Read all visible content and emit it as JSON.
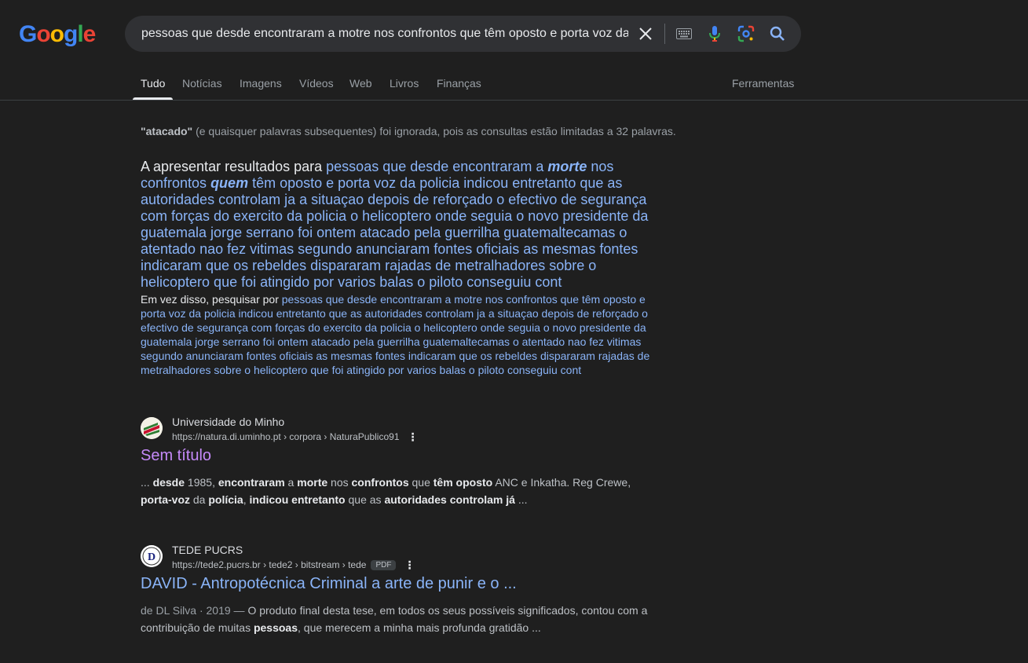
{
  "header": {
    "logo_text": "Google",
    "search_query": "pessoas que desde encontraram a motre nos confrontos que têm oposto e porta voz da policia indicou",
    "icons": [
      "close-icon",
      "keyboard-icon",
      "microphone-icon",
      "lens-icon",
      "search-icon"
    ]
  },
  "tabs": [
    "Tudo",
    "Notícias",
    "Imagens",
    "Vídeos",
    "Web",
    "Livros",
    "Finanças"
  ],
  "active_tab": "Tudo",
  "tools_label": "Ferramentas",
  "notice": {
    "term": "\"atacado\"",
    "rest": " (e quaisquer palavras subsequentes) foi ignorada, pois as consultas estão limitadas a 32 palavras."
  },
  "correction": {
    "prefix": "A apresentar resultados para ",
    "q_part1": "pessoas que desde encontraram a ",
    "q_em1": "morte",
    "q_part2": " nos confrontos ",
    "q_em2": "quem",
    "q_part3": " têm oposto e porta voz da policia indicou entretanto que as autoridades controlam ja a situaçao depois de reforçado o efectivo de segurança com forças do exercito da policia o helicoptero onde seguia o novo presidente da guatemala jorge serrano foi ontem atacado pela guerrilha guatemaltecamas o atentado nao fez vitimas segundo anunciaram fontes oficiais as mesmas fontes indicaram que os rebeldes dispararam rajadas de metralhadores sobre o helicoptero que foi atingido por varios balas o piloto conseguiu cont",
    "instead_prefix": "Em vez disso, pesquisar por ",
    "instead_query": "pessoas que desde encontraram a motre nos confrontos que têm oposto e porta voz da policia indicou entretanto que as autoridades controlam ja a situaçao depois de reforçado o efectivo de segurança com forças do exercito da policia o helicoptero onde seguia o novo presidente da guatemala jorge serrano foi ontem atacado pela guerrilha guatemaltecamas o atentado nao fez vitimas segundo anunciaram fontes oficiais as mesmas fontes indicaram que os rebeldes dispararam rajadas de metralhadores sobre o helicoptero que foi atingido por varios balas o piloto conseguiu cont"
  },
  "results": [
    {
      "site": "Universidade do Minho",
      "url": "https://natura.di.uminho.pt › corpora › NaturaPublico91",
      "title": "Sem título",
      "snippet": {
        "s1": "... ",
        "b1": "desde",
        "s2": " 1985, ",
        "b2": "encontraram",
        "s3": " a ",
        "b3": "morte",
        "s4": " nos ",
        "b4": "confrontos",
        "s5": " que ",
        "b5": "têm oposto",
        "s6": " ANC e Inkatha. Reg Crewe, ",
        "b6": "porta-voz",
        "s7": " da ",
        "b7": "polícia",
        "s8": ", ",
        "b8": "indicou entretanto",
        "s9": " que as ",
        "b9": "autoridades controlam já",
        "s10": " ..."
      }
    },
    {
      "site": "TEDE PUCRS",
      "url": "https://tede2.pucrs.br › tede2 › bitstream › tede",
      "badge": "PDF",
      "title": "DAVID - Antropotécnica Criminal a arte de punir e o ...",
      "snippet": {
        "meta": "de DL Silva · 2019 — ",
        "s1": "O produto final desta tese, em todos os seus possíveis significados, contou com a contribuição de muitas ",
        "b1": "pessoas",
        "s2": ", que merecem a minha mais profunda gratidão ..."
      }
    }
  ]
}
